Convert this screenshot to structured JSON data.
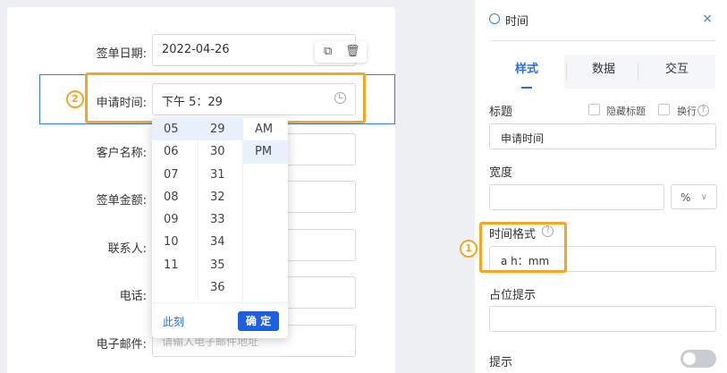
{
  "form": {
    "rows": [
      {
        "label": "签单日期:",
        "value": "2022-04-26"
      },
      {
        "label": "申请时间:",
        "value": "下午 5：29"
      },
      {
        "label": "客户名称:",
        "value": ""
      },
      {
        "label": "签单金额:",
        "value": ""
      },
      {
        "label": "联系人:",
        "value": ""
      },
      {
        "label": "电话:",
        "value": ""
      },
      {
        "label": "电子邮件:",
        "placeholder": "请输入电子邮件地址"
      }
    ]
  },
  "picker": {
    "hours": [
      "05",
      "06",
      "07",
      "08",
      "09",
      "10",
      "11"
    ],
    "minutes": [
      "29",
      "30",
      "31",
      "32",
      "33",
      "34",
      "35",
      "36"
    ],
    "meridiem": [
      "AM",
      "PM"
    ],
    "selected": {
      "hour": "05",
      "minute": "29",
      "meridiem": "PM"
    },
    "now_label": "此刻",
    "ok_label": "确 定"
  },
  "badges": {
    "one": "1",
    "two": "2"
  },
  "panel": {
    "title": "时间",
    "close": "×",
    "tabs": [
      "样式",
      "数据",
      "交互"
    ],
    "active_tab": "样式",
    "title_section": {
      "label": "标题",
      "value": "申请时间",
      "hide_label": "隐藏标题",
      "wrap_label": "换行"
    },
    "width_section": {
      "label": "宽度",
      "value": "",
      "unit": "%"
    },
    "format_section": {
      "label": "时间格式",
      "value": "a h：mm"
    },
    "placeholder_section": {
      "label": "占位提示",
      "value": ""
    },
    "tip_section": {
      "label": "提示",
      "enabled": false
    }
  },
  "colors": {
    "accent": "#f5a623",
    "primary": "#1c5fe0",
    "selection": "#3b7bd9"
  }
}
